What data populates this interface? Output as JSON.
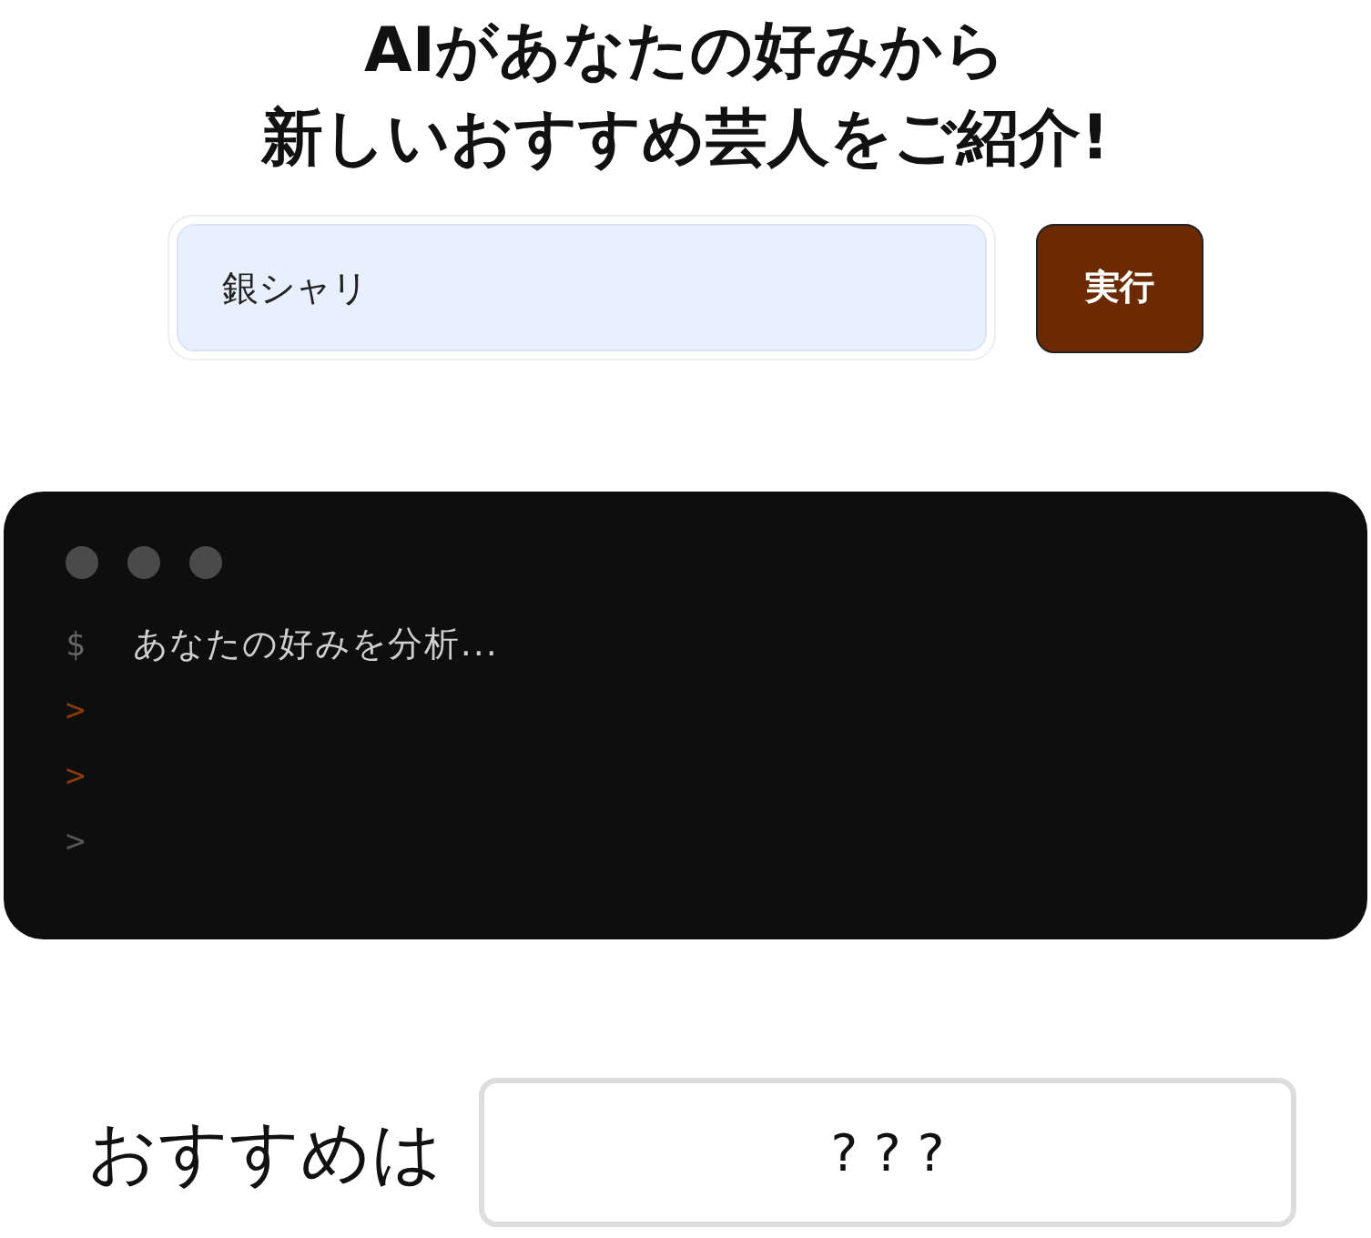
{
  "title_lines": [
    "AIがあなたの好みから",
    "新しいおすすめ芸人をご紹介!"
  ],
  "search": {
    "value": "銀シャリ"
  },
  "run_button": "実行",
  "terminal": {
    "lines": [
      {
        "kind": "command",
        "prompt": "$",
        "text": "あなたの好みを分析..."
      },
      {
        "kind": "active",
        "prompt": ">"
      },
      {
        "kind": "active",
        "prompt": ">"
      },
      {
        "kind": "idle",
        "prompt": ">"
      }
    ]
  },
  "result": {
    "label": "おすすめは",
    "value": "? ? ?"
  }
}
